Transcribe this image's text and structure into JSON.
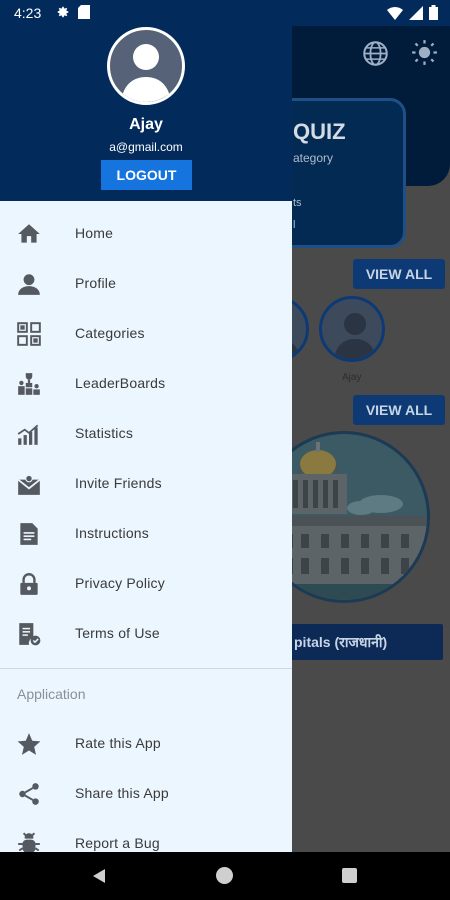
{
  "status_bar": {
    "time": "4:23"
  },
  "background": {
    "quiz_card": {
      "title": "QUIZ",
      "subtitle": "ategory",
      "line1": "ts",
      "line2": "l"
    },
    "view_all_1": "VIEW ALL",
    "view_all_2": "VIEW ALL",
    "leader_name": "Ajay",
    "capital_label": "pitals (राजधानी)"
  },
  "drawer": {
    "user": {
      "name": "Ajay",
      "email": "a@gmail.com"
    },
    "logout_label": "LOGOUT",
    "items": [
      {
        "label": "Home",
        "icon": "home-icon"
      },
      {
        "label": "Profile",
        "icon": "person-icon"
      },
      {
        "label": "Categories",
        "icon": "categories-icon"
      },
      {
        "label": "LeaderBoards",
        "icon": "leaderboard-icon"
      },
      {
        "label": "Statistics",
        "icon": "statistics-icon"
      },
      {
        "label": "Invite Friends",
        "icon": "invite-icon"
      },
      {
        "label": "Instructions",
        "icon": "document-icon"
      },
      {
        "label": "Privacy Policy",
        "icon": "lock-icon"
      },
      {
        "label": "Terms of Use",
        "icon": "terms-icon"
      }
    ],
    "section_title": "Application",
    "app_items": [
      {
        "label": "Rate this App",
        "icon": "star-icon"
      },
      {
        "label": "Share this App",
        "icon": "share-icon"
      },
      {
        "label": "Report a Bug",
        "icon": "bug-icon"
      }
    ]
  },
  "colors": {
    "header_navy": "#022b5c",
    "logout_blue": "#1574dd",
    "drawer_bg": "#ecf6ff",
    "icon_gray": "#555a60"
  }
}
